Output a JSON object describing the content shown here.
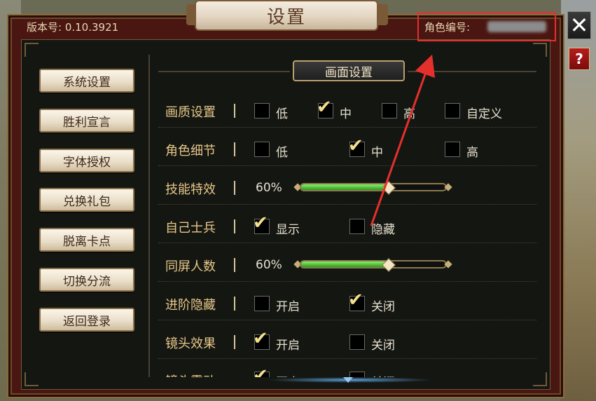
{
  "window": {
    "title": "设置",
    "version_label": "版本号: 0.10.3921",
    "role_id_label": "角色编号:"
  },
  "controls": {
    "close_glyph": "✕",
    "help_glyph": "?"
  },
  "sidebar": {
    "items": [
      {
        "label": "系统设置"
      },
      {
        "label": "胜利宣言"
      },
      {
        "label": "字体授权"
      },
      {
        "label": "兑换礼包"
      },
      {
        "label": "脱离卡点"
      },
      {
        "label": "切换分流"
      },
      {
        "label": "返回登录"
      }
    ]
  },
  "section": {
    "title": "画面设置"
  },
  "settings": {
    "quality": {
      "label": "画质设置",
      "options": [
        "低",
        "中",
        "高",
        "自定义"
      ],
      "selected": "中"
    },
    "role_detail": {
      "label": "角色细节",
      "options": [
        "低",
        "中",
        "高"
      ],
      "selected": "中"
    },
    "skill_effects": {
      "label": "技能特效",
      "value_text": "60%",
      "value": 0.6
    },
    "own_soldiers": {
      "label": "自己士兵",
      "options": [
        "显示",
        "隐藏"
      ],
      "selected": "显示"
    },
    "same_screen": {
      "label": "同屏人数",
      "value_text": "60%",
      "value": 0.6
    },
    "advanced_hide": {
      "label": "进阶隐藏",
      "options": [
        "开启",
        "关闭"
      ],
      "selected": "关闭"
    },
    "camera_effect": {
      "label": "镜头效果",
      "options": [
        "开启",
        "关闭"
      ],
      "selected": "开启"
    },
    "camera_shake": {
      "label": "镜头震动",
      "options": [
        "开启",
        "关闭"
      ],
      "selected": "开启"
    }
  },
  "colors": {
    "annotation": "#e4302c",
    "label_gold": "#e8c88a",
    "slider_green": "#3cc02a"
  },
  "icons": {
    "close": "close-icon",
    "help": "help-icon",
    "check": "checkmark-icon",
    "scroll": "scroll-down-icon"
  }
}
